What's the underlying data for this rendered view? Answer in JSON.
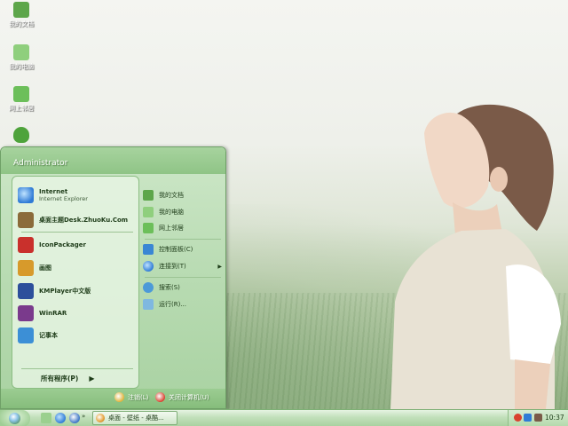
{
  "desktop": {
    "icons": [
      {
        "label": "我的文档",
        "icon": "my-documents-icon",
        "color": "#5da64a"
      },
      {
        "label": "我的电脑",
        "icon": "my-computer-icon",
        "color": "#8fcf7d"
      },
      {
        "label": "网上邻居",
        "icon": "network-places-icon",
        "color": "#6cbf5a"
      },
      {
        "label": "",
        "icon": "recycle-bin-icon",
        "color": "#4ea33b"
      }
    ]
  },
  "start_menu": {
    "user": "Administrator",
    "pinned": [
      {
        "title": "Internet",
        "subtitle": "Internet Explorer",
        "icon": "internet-explorer-icon",
        "color": "#2f7bd6"
      },
      {
        "title": "桌面主题Desk.ZhuoKu.Com",
        "subtitle": "",
        "icon": "zhuoku-theme-icon",
        "color": "#8b6b3a"
      },
      {
        "title": "IconPackager",
        "subtitle": "",
        "icon": "iconpackager-icon",
        "color": "#c9302c"
      },
      {
        "title": "画图",
        "subtitle": "",
        "icon": "paint-icon",
        "color": "#d79a2b"
      },
      {
        "title": "KMPlayer中文版",
        "subtitle": "",
        "icon": "kmplayer-icon",
        "color": "#2c4f9b"
      },
      {
        "title": "WinRAR",
        "subtitle": "",
        "icon": "winrar-icon",
        "color": "#7a3a8c"
      },
      {
        "title": "记事本",
        "subtitle": "",
        "icon": "notepad-icon",
        "color": "#3c8fd6"
      }
    ],
    "all_programs": "所有程序(P)",
    "right_items": [
      {
        "label": "我的文档",
        "icon": "my-documents-icon",
        "color": "#5da64a"
      },
      {
        "label": "我的电脑",
        "icon": "my-computer-icon",
        "color": "#8fcf7d"
      },
      {
        "label": "网上邻居",
        "icon": "network-places-icon",
        "color": "#6cbf5a"
      },
      {
        "label": "控制面板(C)",
        "icon": "control-panel-icon",
        "color": "#3a86d4"
      },
      {
        "label": "连接到(T)",
        "icon": "connect-to-icon",
        "color": "#2f7bd6"
      },
      {
        "label": "搜索(S)",
        "icon": "search-icon",
        "color": "#4c9ad8"
      },
      {
        "label": "运行(R)...",
        "icon": "run-icon",
        "color": "#7fb8e0"
      }
    ],
    "logoff": "注销(L)",
    "shutdown": "关闭计算机(U)"
  },
  "taskbar": {
    "task_label": "桌面 - 壁纸 - 桌酷...",
    "clock": "10:37",
    "quick_launch": [
      "show-desktop-icon",
      "internet-explorer-icon",
      "media-player-icon"
    ]
  },
  "colors": {
    "accent": "#8fc486",
    "wallpaper_top": "#f4f5f1",
    "wallpaper_bottom": "#8fae80"
  }
}
